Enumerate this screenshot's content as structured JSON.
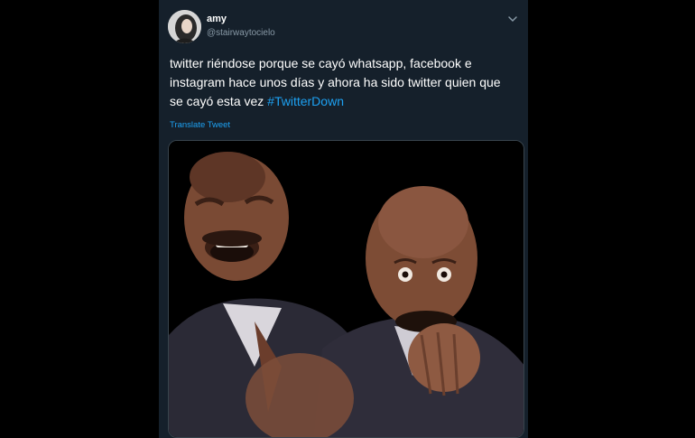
{
  "tweet": {
    "display_name": "amy",
    "handle": "@stairwaytocielo",
    "text": "twitter riéndose porque se cayó whatsapp, facebook e instagram hace unos días y ahora ha sido twitter quien que se cayó esta vez ",
    "hashtag": "#TwitterDown",
    "translate_label": "Translate Tweet"
  },
  "icons": {
    "more_menu": "chevron-down-icon"
  },
  "colors": {
    "background": "#15202b",
    "text": "#ffffff",
    "secondary_text": "#8899a6",
    "link": "#1da1f2",
    "border": "#38444d"
  }
}
